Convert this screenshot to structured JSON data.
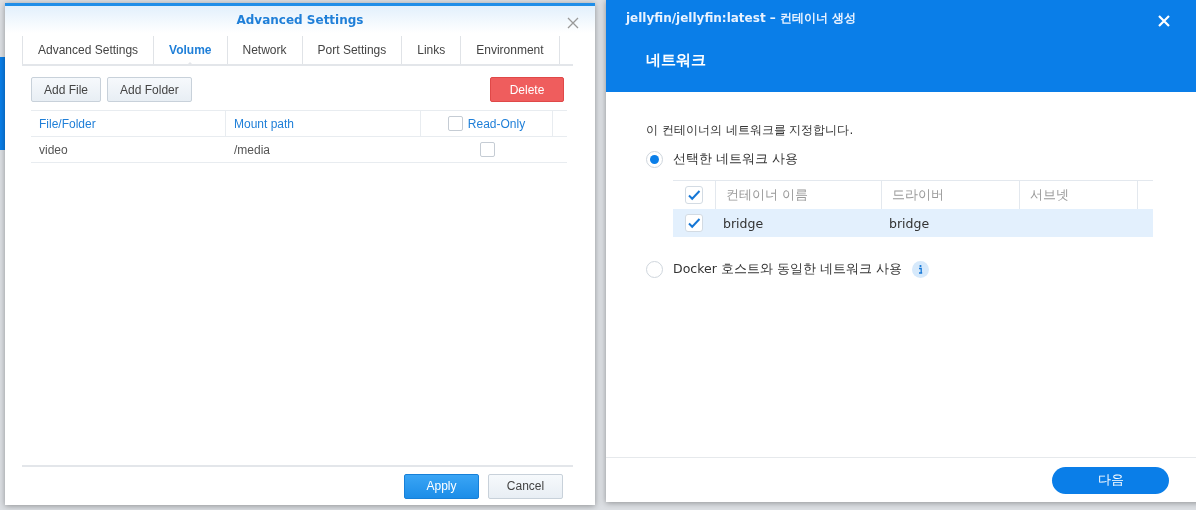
{
  "left_dialog": {
    "title": "Advanced Settings",
    "tabs": [
      {
        "label": "Advanced Settings",
        "selected": false
      },
      {
        "label": "Volume",
        "selected": true
      },
      {
        "label": "Network",
        "selected": false
      },
      {
        "label": "Port Settings",
        "selected": false
      },
      {
        "label": "Links",
        "selected": false
      },
      {
        "label": "Environment",
        "selected": false
      }
    ],
    "toolbar": [
      {
        "label": "Add File",
        "kind": "plain"
      },
      {
        "label": "Add Folder",
        "kind": "plain"
      },
      {
        "label": "Delete",
        "kind": "danger"
      }
    ],
    "table": {
      "columns": [
        "File/Folder",
        "Mount path",
        "Read-Only"
      ],
      "header_checked": false,
      "rows": [
        {
          "file": "video",
          "mount": "/media",
          "read_only": false
        }
      ]
    },
    "buttons": [
      {
        "label": "Apply",
        "kind": "primary"
      },
      {
        "label": "Cancel",
        "kind": "plain"
      }
    ]
  },
  "right_dialog": {
    "title": "jellyfin/jellyfin:latest – 컨테이너 생성",
    "heading": "네트워크",
    "description": "이 컨테이너의 네트워크를 지정합니다.",
    "options": [
      {
        "label": "선택한 네트워크 사용",
        "selected": true
      },
      {
        "label": "Docker 호스트와 동일한 네트워크 사용",
        "selected": false,
        "info": true
      }
    ],
    "table": {
      "columns": [
        "컨테이너 이름",
        "드라이버",
        "서브넷"
      ],
      "header_checked": true,
      "rows": [
        {
          "name": "bridge",
          "driver": "bridge",
          "subnet": "",
          "checked": true,
          "selected": true
        }
      ]
    },
    "next_button": "다음"
  }
}
